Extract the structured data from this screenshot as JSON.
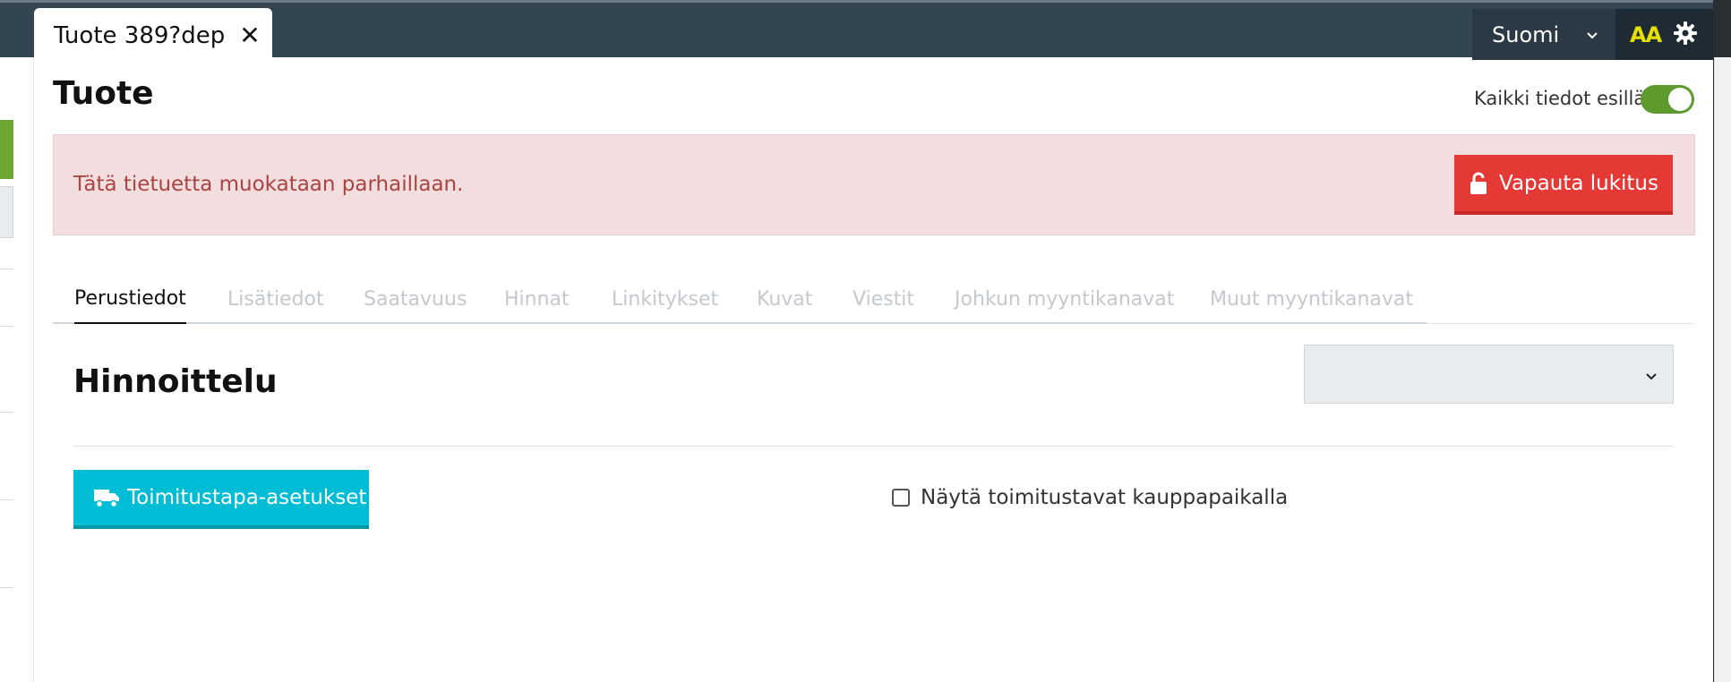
{
  "tab": {
    "title": "Tuote 389?dep",
    "close": "✕"
  },
  "topbar": {
    "language": "Suomi",
    "font_size_label": "AA"
  },
  "page": {
    "title": "Tuote",
    "show_all_label": "Kaikki tiedot esillä",
    "show_all_on": true
  },
  "alert": {
    "message": "Tätä tietuetta muokataan parhaillaan.",
    "unlock_label": "Vapauta lukitus"
  },
  "tabs": [
    {
      "label": "Perustiedot",
      "active": true
    },
    {
      "label": "Lisätiedot",
      "active": false
    },
    {
      "label": "Saatavuus",
      "active": false
    },
    {
      "label": "Hinnat",
      "active": false
    },
    {
      "label": "Linkitykset",
      "active": false
    },
    {
      "label": "Kuvat",
      "active": false
    },
    {
      "label": "Viestit",
      "active": false
    },
    {
      "label": "Johkun myyntikanavat",
      "active": false
    },
    {
      "label": "Muut myyntikanavat",
      "active": false
    }
  ],
  "section": {
    "title": "Hinnoittelu",
    "select_value": "",
    "shipping_button": "Toimitustapa-asetukset",
    "show_shipping_label": "Näytä toimitustavat kauppapaikalla",
    "show_shipping_checked": false
  },
  "colors": {
    "topbar": "#344552",
    "alert_bg": "#f2dede",
    "alert_text": "#a94442",
    "danger": "#e53935",
    "toggle_on": "#5f9a2e",
    "info": "#00bcd4"
  }
}
